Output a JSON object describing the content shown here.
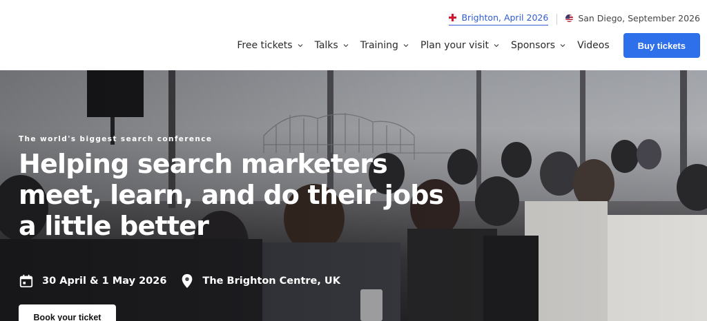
{
  "header": {
    "events": [
      {
        "label": "Brighton, April 2026",
        "flag": "uk-flag-icon",
        "active": true
      },
      {
        "label": "San Diego, September 2026",
        "flag": "us-flag-icon",
        "active": false
      }
    ],
    "nav": [
      {
        "label": "Free tickets",
        "dropdown": true
      },
      {
        "label": "Talks",
        "dropdown": true
      },
      {
        "label": "Training",
        "dropdown": true
      },
      {
        "label": "Plan your visit",
        "dropdown": true
      },
      {
        "label": "Sponsors",
        "dropdown": true
      },
      {
        "label": "Videos",
        "dropdown": false
      }
    ],
    "cta_label": "Buy tickets",
    "cta_color": "#2e6fea"
  },
  "hero": {
    "tagline": "The world's biggest search conference",
    "headline_lines": [
      "Helping search marketers",
      "meet, learn, and do their jobs",
      "a little better"
    ],
    "date": "30 April & 1 May 2026",
    "date_icon": "calendar-icon",
    "location": "The Brighton Centre, UK",
    "location_icon": "location-pin-icon",
    "button_label": "Book your ticket"
  }
}
